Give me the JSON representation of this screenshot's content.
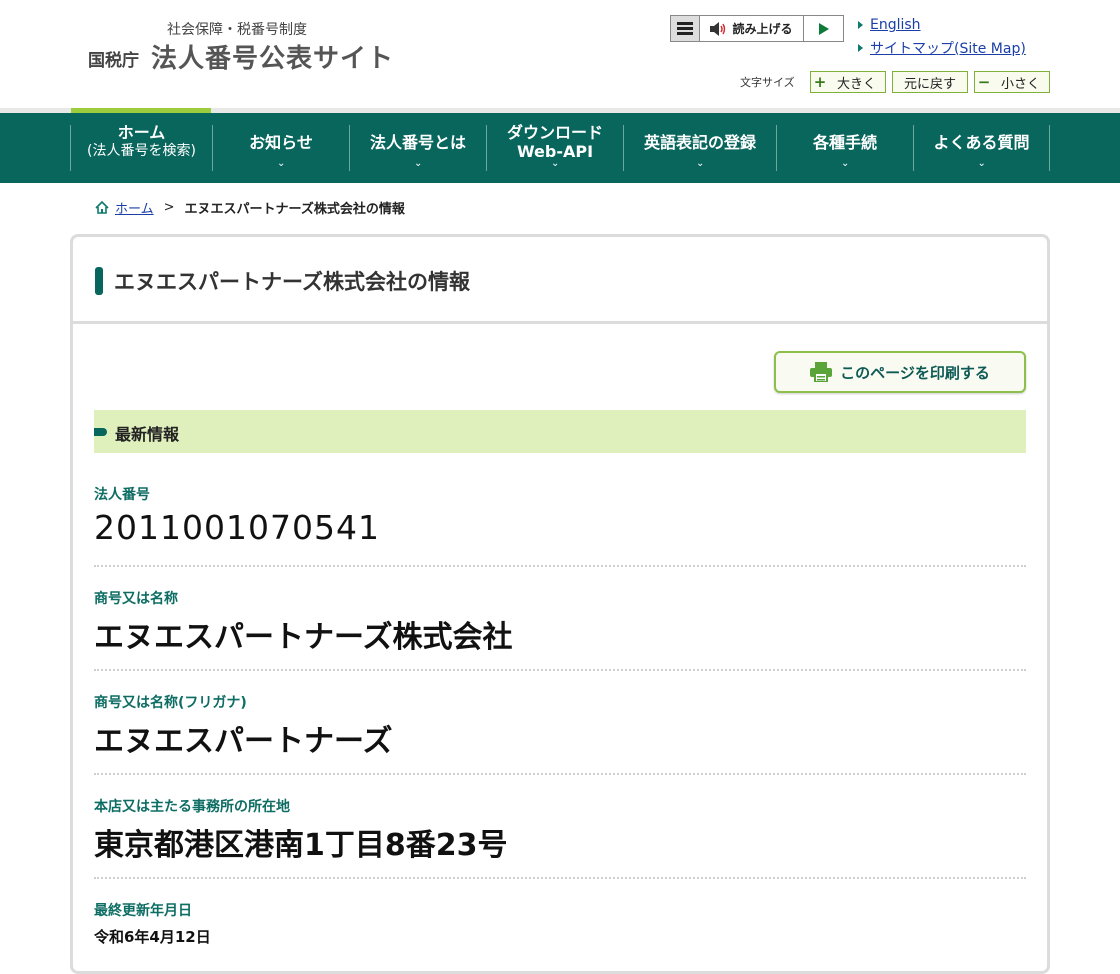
{
  "header": {
    "subtitle": "社会保障・税番号制度",
    "agency": "国税庁",
    "site_title": "法人番号公表サイト",
    "reader_label": "読み上げる",
    "links": [
      {
        "label": "English"
      },
      {
        "label": "サイトマップ(Site Map)"
      }
    ],
    "font_size": {
      "label": "文字サイズ",
      "larger": "大きく",
      "reset": "元に戻す",
      "smaller": "小さく"
    }
  },
  "nav": {
    "items": [
      {
        "line1": "ホーム",
        "line2": "(法人番号を検索)"
      },
      {
        "line1": "お知らせ",
        "line2": ""
      },
      {
        "line1": "法人番号とは",
        "line2": ""
      },
      {
        "line1": "ダウンロード",
        "line2": "Web-API"
      },
      {
        "line1": "英語表記の登録",
        "line2": ""
      },
      {
        "line1": "各種手続",
        "line2": ""
      },
      {
        "line1": "よくある質問",
        "line2": ""
      }
    ]
  },
  "breadcrumb": {
    "home": "ホーム",
    "separator": ">",
    "current": "エヌエスパートナーズ株式会社の情報"
  },
  "card": {
    "title": "エヌエスパートナーズ株式会社の情報",
    "print_label": "このページを印刷する",
    "section_title": "最新情報",
    "fields": [
      {
        "label": "法人番号",
        "value": "2011001070541"
      },
      {
        "label": "商号又は名称",
        "value": "エヌエスパートナーズ株式会社"
      },
      {
        "label": "商号又は名称(フリガナ)",
        "value": "エヌエスパートナーズ"
      },
      {
        "label": "本店又は主たる事務所の所在地",
        "value": "東京都港区港南1丁目8番23号"
      },
      {
        "label": "最終更新年月日",
        "value": "令和6年4月12日"
      }
    ]
  },
  "colors": {
    "brand_green": "#08665d",
    "accent_lime": "#9ccd3c",
    "section_bg": "#dff0bc",
    "label_green": "#0d6d63",
    "link_blue": "#1a3fa8"
  }
}
